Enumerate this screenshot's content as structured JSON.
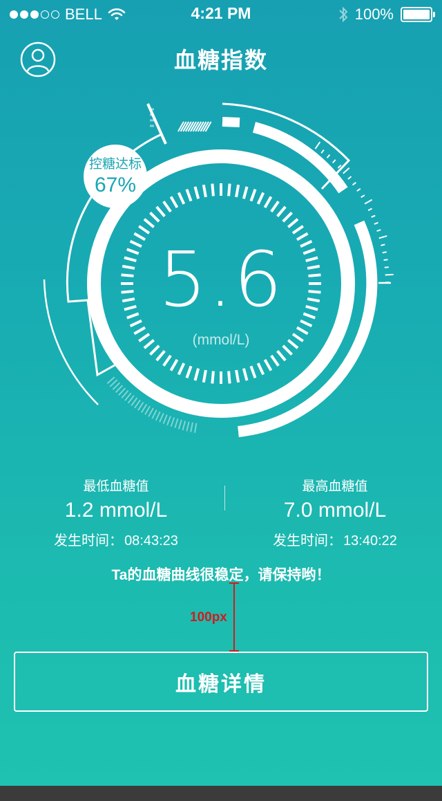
{
  "status_bar": {
    "carrier": "BELL",
    "time": "4:21 PM",
    "battery": "100%",
    "signal_dots_filled": 3,
    "signal_dots_total": 5,
    "icons": [
      "wifi-icon",
      "bluetooth-icon",
      "battery-icon"
    ]
  },
  "header": {
    "title": "血糖指数",
    "profile_icon": "user-icon"
  },
  "gauge": {
    "value": "5.6",
    "unit": "(mmol/L)",
    "control_badge": {
      "label": "控糖达标",
      "value": "67%"
    }
  },
  "stats": {
    "min": {
      "label": "最低血糖值",
      "value": "1.2 mmol/L",
      "time_label": "发生时间：",
      "time": "08:43:23"
    },
    "max": {
      "label": "最高血糖值",
      "value": "7.0 mmol/L",
      "time_label": "发生时间：",
      "time": "13:40:22"
    }
  },
  "message": "Ta的血糖曲线很稳定，请保持哟！",
  "annotation": {
    "label": "100px"
  },
  "detail_button": {
    "label": "血糖详情"
  },
  "colors": {
    "bg_top": "#17a0b2",
    "bg_bottom": "#1fc2b0",
    "annotation": "#d01c1c"
  }
}
